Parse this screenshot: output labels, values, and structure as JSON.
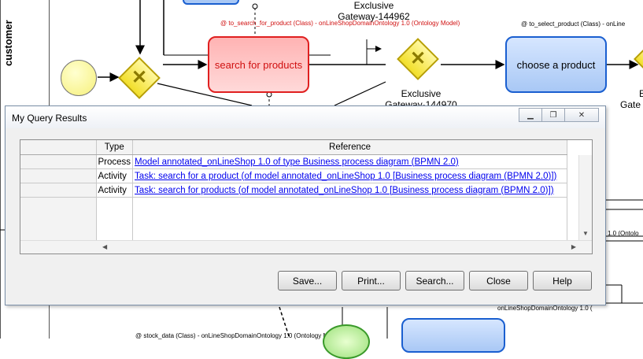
{
  "canvas": {
    "lane_label": "customer",
    "tasks": {
      "search_for_products": "search for products",
      "choose_a_product": "choose a product"
    },
    "gateways": {
      "top_caption_line1": "Exclusive",
      "top_caption_line2": "Gateway-144962",
      "right_caption_line1": "Exclusive",
      "right_caption_line2": "Gateway-144970",
      "far_right_line1": "E",
      "far_right_line2": "Gate"
    },
    "annotations": {
      "to_search_for_product": "@ to_search_for_product (Class) - onLineShopDomainOntology 1.0 (Ontology Model)",
      "to_select_product": "@ to_select_product (Class) - onLine",
      "stock_data": "@ stock_data (Class) - onLineShopDomainOntology 1.0 (Ontology M",
      "bottom_right": "onLineShopDomainOntology 1.0 (",
      "side_right": "1.0 (Ontolo"
    }
  },
  "dialog": {
    "title": "My Query Results",
    "window_controls": [
      "minimize",
      "restore",
      "close"
    ],
    "columns": [
      "Type",
      "Reference"
    ],
    "rows": [
      {
        "type": "Process",
        "reference": "Model annotated_onLineShop 1.0 of type Business process diagram (BPMN 2.0)"
      },
      {
        "type": "Activity",
        "reference": "Task: search for a product (of model annotated_onLineShop 1.0 [Business process diagram (BPMN 2.0)])"
      },
      {
        "type": "Activity",
        "reference": "Task: search for products (of model annotated_onLineShop 1.0 [Business process diagram (BPMN 2.0)])"
      }
    ],
    "buttons": {
      "save": "Save...",
      "print": "Print...",
      "search": "Search...",
      "close": "Close",
      "help": "Help"
    }
  }
}
